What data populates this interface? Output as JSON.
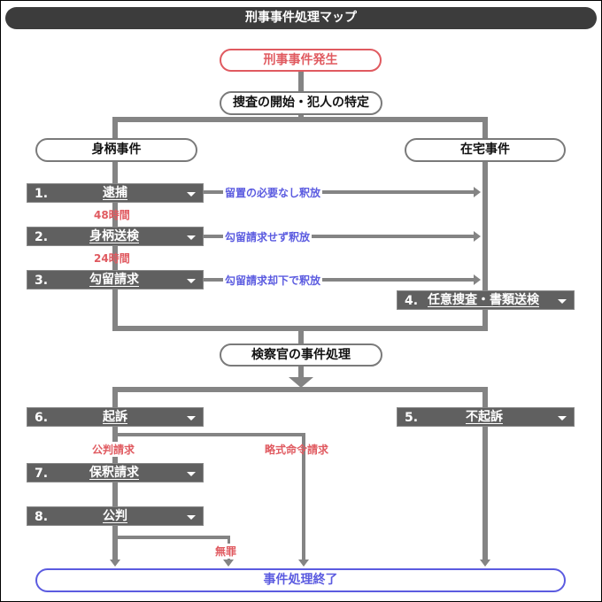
{
  "title": "刑事事件処理マップ",
  "nodes": {
    "start": "刑事事件発生",
    "investigation": "捜査の開始・犯人の特定",
    "custody_case": "身柄事件",
    "home_case": "在宅事件",
    "prosecutor": "検察官の事件処理",
    "end": "事件処理終了"
  },
  "steps": [
    {
      "num": "1.",
      "label": "逮捕"
    },
    {
      "num": "2.",
      "label": "身柄送検"
    },
    {
      "num": "3.",
      "label": "勾留請求"
    },
    {
      "num": "4.",
      "label": "任意捜査・書類送検"
    },
    {
      "num": "5.",
      "label": "不起訴"
    },
    {
      "num": "6.",
      "label": "起訴"
    },
    {
      "num": "7.",
      "label": "保釈請求"
    },
    {
      "num": "8.",
      "label": "公判"
    }
  ],
  "notes": {
    "time_48": "48時間",
    "time_24": "24時間",
    "release_1": "留置の必要なし釈放",
    "release_2": "勾留請求せず釈放",
    "release_3": "勾留請求却下で釈放",
    "public_trial_request": "公判請求",
    "summary_order_request": "略式命令請求",
    "not_guilty": "無罪"
  },
  "colors": {
    "title_bg": "#3c3c3c",
    "step_bg": "#606060",
    "connector": "#848484",
    "accent_red": "#e05a60",
    "accent_blue": "#5b5be0"
  }
}
